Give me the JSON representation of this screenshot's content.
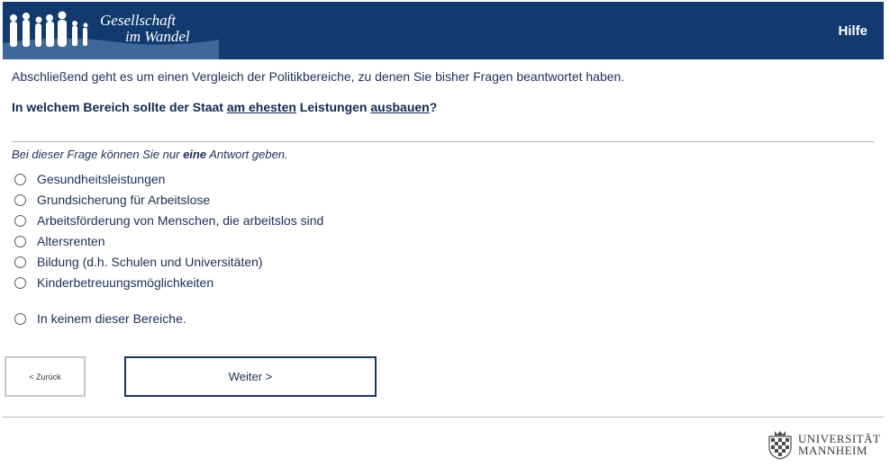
{
  "header": {
    "logo_line1": "Gesellschaft",
    "logo_line2": "im Wandel",
    "help_label": "Hilfe"
  },
  "main": {
    "intro": "Abschließend geht es um einen Vergleich der Politikbereiche, zu denen Sie bisher Fragen beantwortet haben.",
    "question": {
      "part1": "In welchem Bereich sollte der Staat ",
      "em1": "am ehesten",
      "part2": " Leistungen ",
      "em2": "ausbauen",
      "part3": "?"
    },
    "instruction": {
      "pre": "Bei dieser Frage können Sie nur ",
      "bold": "eine",
      "post": " Antwort geben."
    },
    "options": [
      "Gesundheitsleistungen",
      "Grundsicherung für Arbeitslose",
      "Arbeitsförderung von Menschen, die arbeitslos sind",
      "Altersrenten",
      "Bildung (d.h. Schulen und Universitäten)",
      "Kinderbetreuungsmöglichkeiten",
      "In keinem dieser Bereiche."
    ]
  },
  "nav": {
    "back_label": "< Zurück",
    "next_label": "Weiter >"
  },
  "footer": {
    "uni_line1": "UNIVERSITÄT",
    "uni_line2": "MANNHEIM"
  }
}
